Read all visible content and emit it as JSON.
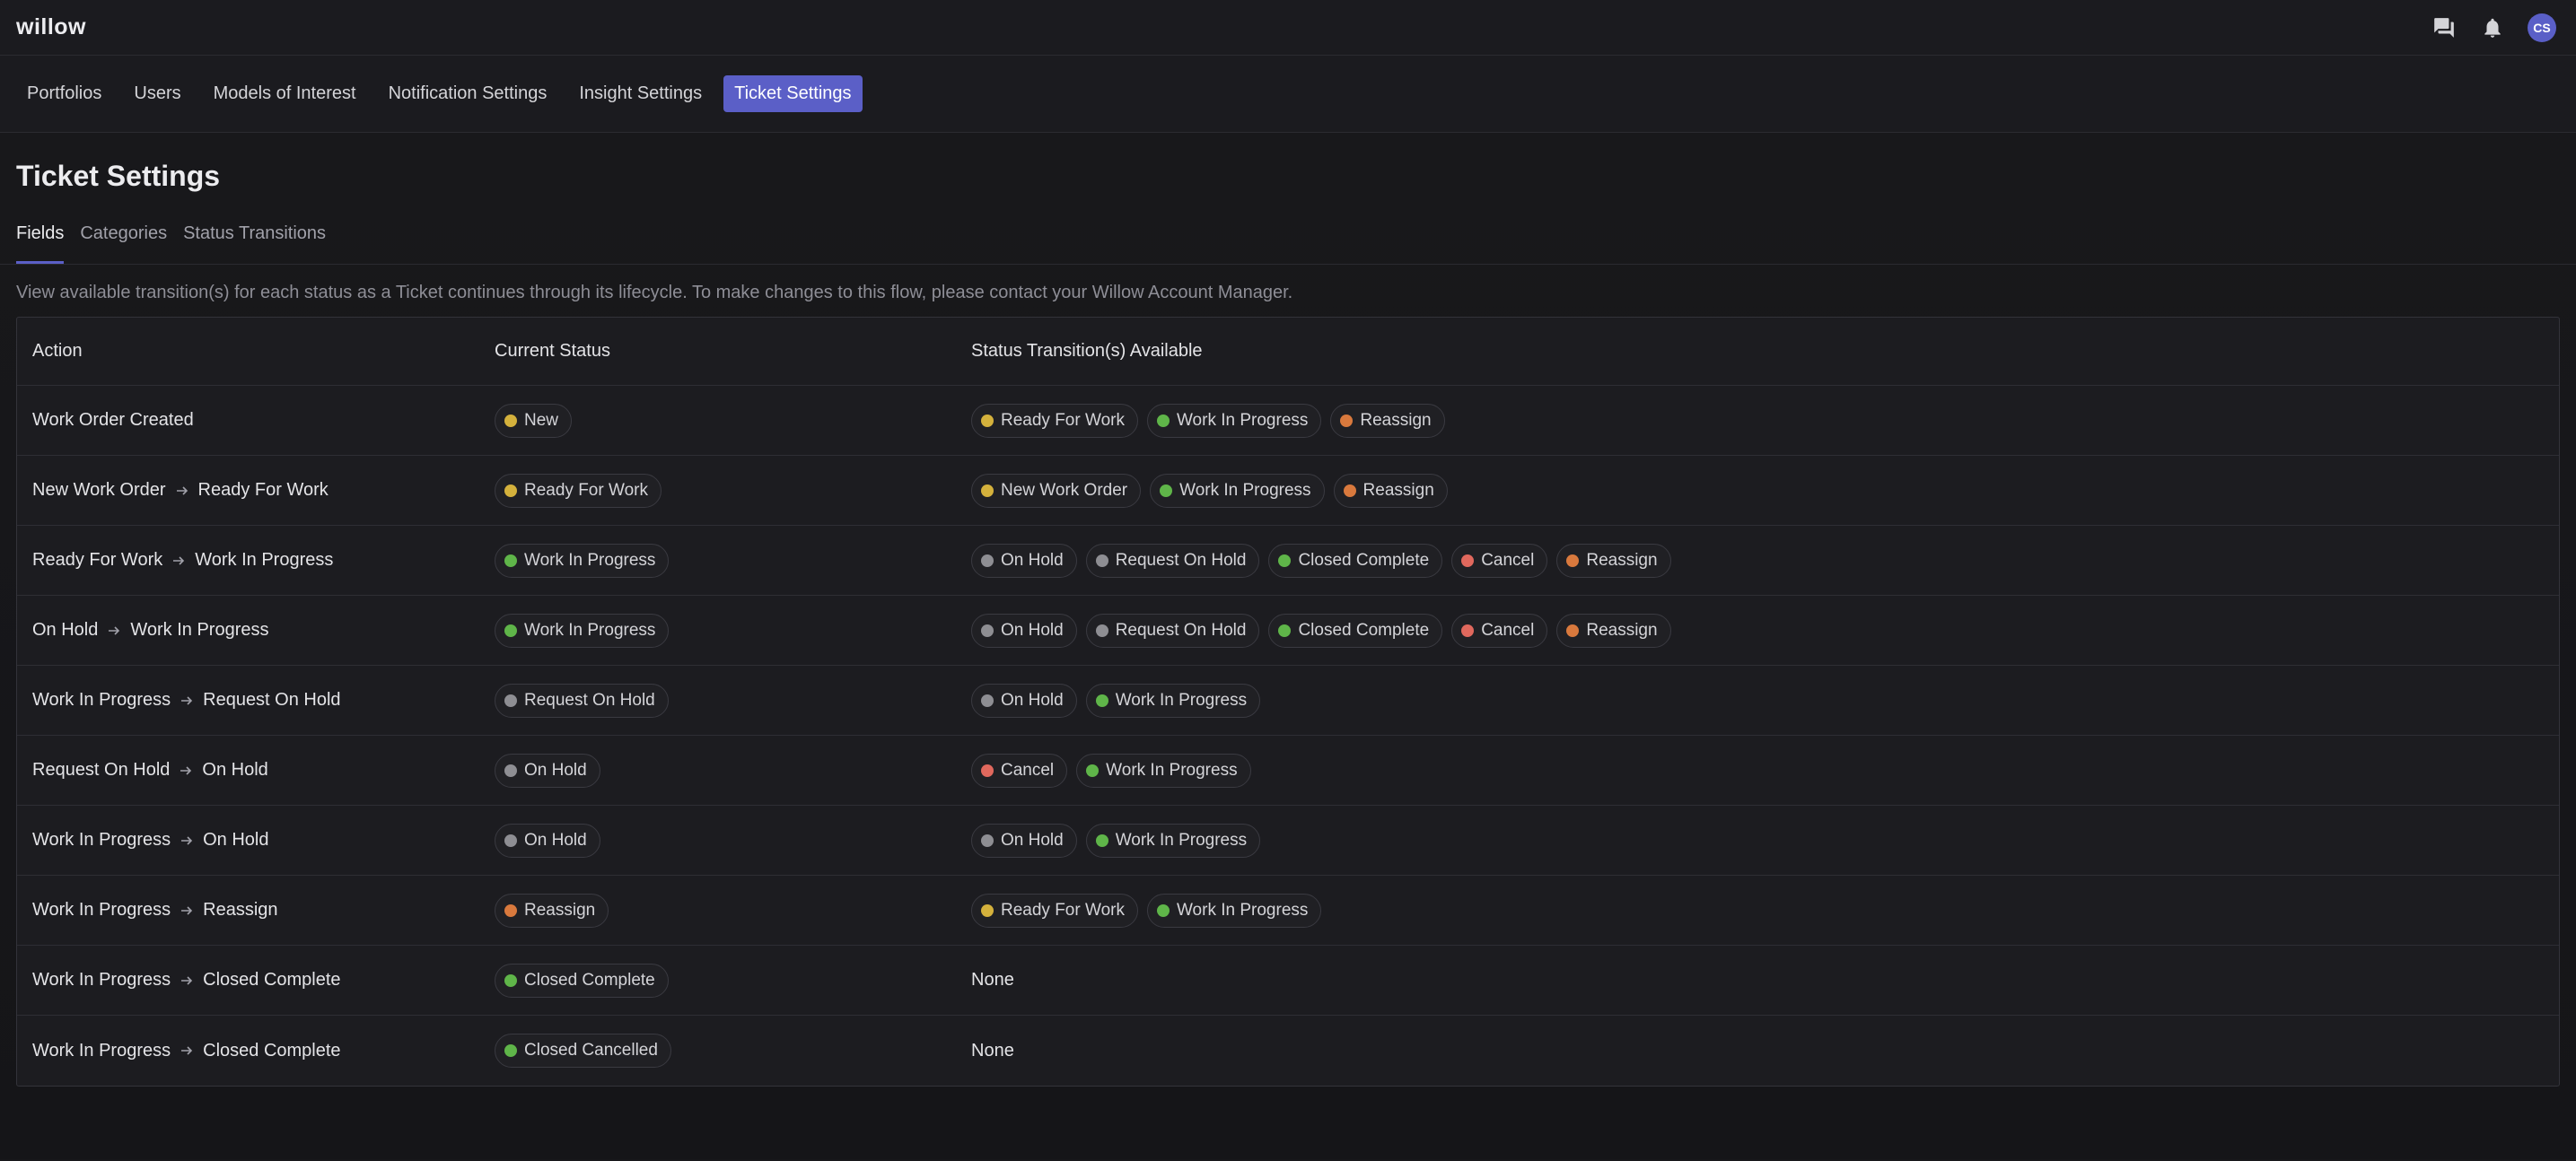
{
  "app": {
    "logo": "willow"
  },
  "user": {
    "initials": "CS"
  },
  "nav": [
    {
      "label": "Portfolios",
      "active": false
    },
    {
      "label": "Users",
      "active": false
    },
    {
      "label": "Models of Interest",
      "active": false
    },
    {
      "label": "Notification Settings",
      "active": false
    },
    {
      "label": "Insight Settings",
      "active": false
    },
    {
      "label": "Ticket Settings",
      "active": true
    }
  ],
  "page": {
    "title": "Ticket Settings",
    "description": "View available transition(s) for each status as a Ticket continues through its lifecycle. To make changes to this flow, please contact your Willow Account Manager."
  },
  "tabs": [
    {
      "label": "Fields",
      "active": true
    },
    {
      "label": "Categories",
      "active": false
    },
    {
      "label": "Status Transitions",
      "active": false
    }
  ],
  "table": {
    "headers": {
      "action": "Action",
      "current": "Current Status",
      "transitions": "Status Transition(s) Available"
    },
    "none_label": "None",
    "rows": [
      {
        "from": "Work Order Created",
        "to": null,
        "current": "New",
        "transitions": [
          "Ready For Work",
          "Work In Progress",
          "Reassign"
        ]
      },
      {
        "from": "New Work Order",
        "to": "Ready For Work",
        "current": "Ready For Work",
        "transitions": [
          "New Work Order",
          "Work In Progress",
          "Reassign"
        ]
      },
      {
        "from": "Ready For Work",
        "to": "Work In Progress",
        "current": "Work In Progress",
        "transitions": [
          "On Hold",
          "Request On Hold",
          "Closed Complete",
          "Cancel",
          "Reassign"
        ]
      },
      {
        "from": "On Hold",
        "to": "Work In Progress",
        "current": "Work In Progress",
        "transitions": [
          "On Hold",
          "Request On Hold",
          "Closed Complete",
          "Cancel",
          "Reassign"
        ]
      },
      {
        "from": "Work In Progress",
        "to": "Request On Hold",
        "current": "Request On Hold",
        "transitions": [
          "On Hold",
          "Work In Progress"
        ]
      },
      {
        "from": "Request On Hold",
        "to": "On Hold",
        "current": "On Hold",
        "transitions": [
          "Cancel",
          "Work In Progress"
        ]
      },
      {
        "from": "Work In Progress",
        "to": "On Hold",
        "current": "On Hold",
        "transitions": [
          "On Hold",
          "Work In Progress"
        ]
      },
      {
        "from": "Work In Progress",
        "to": "Reassign",
        "current": "Reassign",
        "transitions": [
          "Ready For Work",
          "Work In Progress"
        ]
      },
      {
        "from": "Work In Progress",
        "to": "Closed Complete",
        "current": "Closed Complete",
        "transitions": []
      },
      {
        "from": "Work In Progress",
        "to": "Closed Complete",
        "current": "Closed Cancelled",
        "transitions": []
      }
    ]
  },
  "status_colors": {
    "New": "#d4b13c",
    "Ready For Work": "#d4b13c",
    "New Work Order": "#d4b13c",
    "Work In Progress": "#5fb549",
    "Closed Complete": "#5fb549",
    "Closed Cancelled": "#5fb549",
    "On Hold": "#8e8e93",
    "Request On Hold": "#8e8e93",
    "Cancel": "#e0685d",
    "Reassign": "#d9793d"
  },
  "icons": {
    "chat": "chat-icon",
    "bell": "bell-icon",
    "arrow": "arrow-right-icon"
  }
}
